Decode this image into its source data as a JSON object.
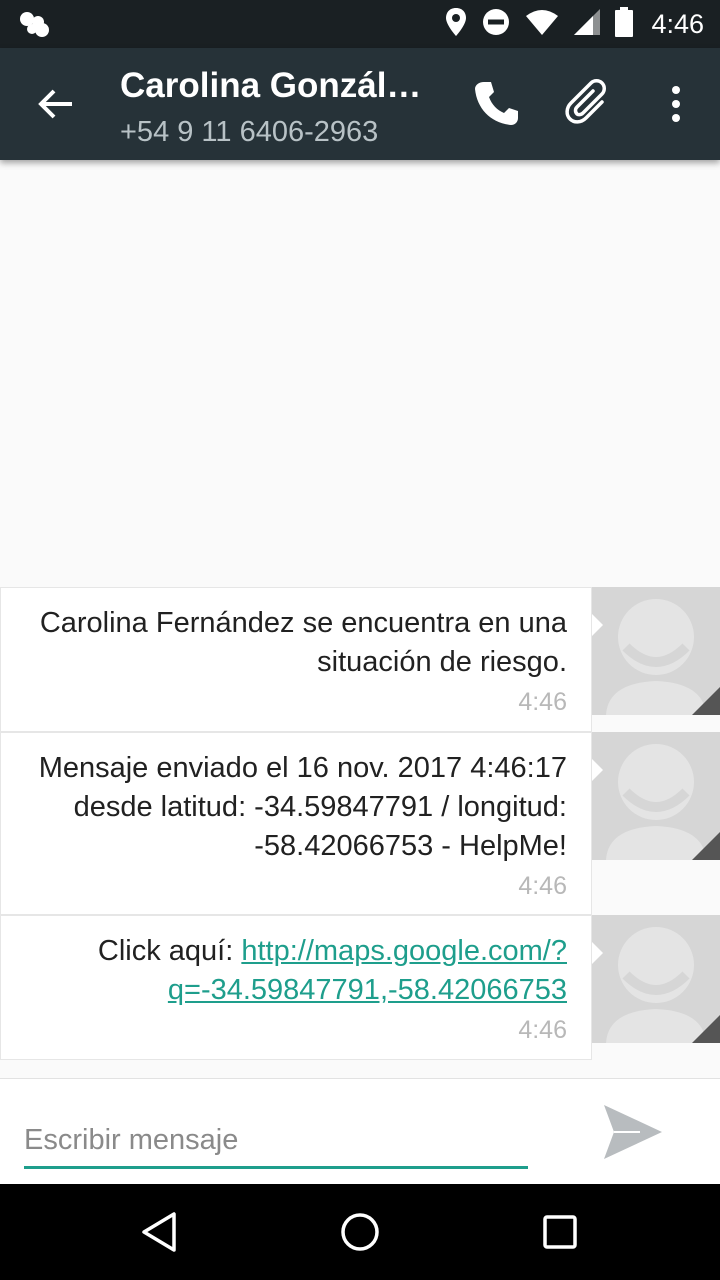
{
  "status_bar": {
    "time": "4:46",
    "icons": [
      "notification-bubbles-icon",
      "location-icon",
      "do-not-disturb-icon",
      "wifi-icon",
      "signal-icon",
      "battery-icon"
    ]
  },
  "toolbar": {
    "title": "Carolina Gonzál…",
    "subtitle": "+54 9 11 6406-2963",
    "icons": [
      "back-arrow-icon",
      "phone-icon",
      "attach-icon",
      "more-vert-icon"
    ]
  },
  "messages": [
    {
      "text": "Carolina Fernández se encuentra en una situación de riesgo.",
      "time": "4:46"
    },
    {
      "text": "Mensaje enviado el 16 nov. 2017 4:46:17 desde latitud: -34.59847791 / longitud: -58.42066753 - HelpMe!",
      "time": "4:46"
    },
    {
      "prefix": "Click aquí: ",
      "link": "http://maps.google.com/?q=-34.59847791,-58.42066753",
      "time": "4:46"
    }
  ],
  "composer": {
    "placeholder": "Escribir mensaje",
    "value": ""
  },
  "colors": {
    "status_bar": "#1a2023",
    "toolbar": "#263238",
    "accent": "#1e9e8c",
    "background": "#fafafa"
  }
}
